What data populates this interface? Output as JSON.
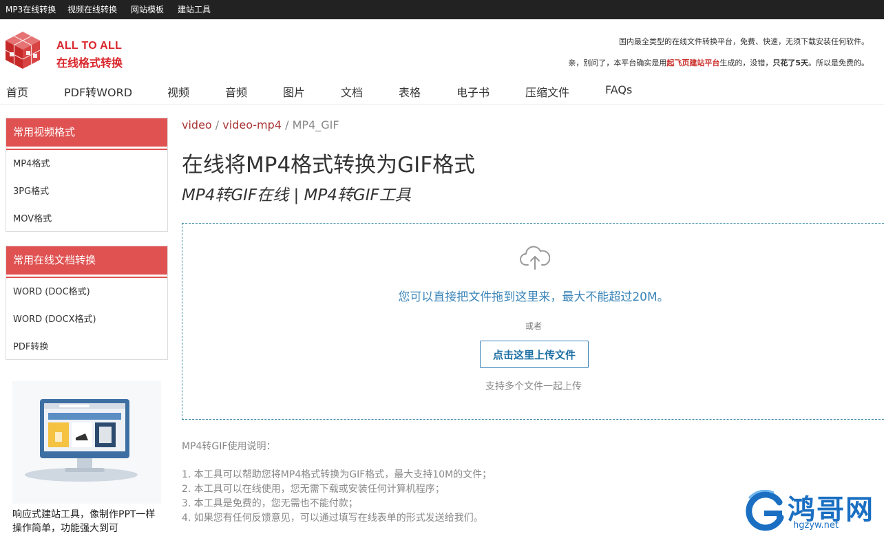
{
  "topnav": [
    "MP3在线转换",
    "视频在线转换",
    "网站模板",
    "建站工具"
  ],
  "brand": {
    "en": "ALL TO ALL",
    "cn": "在线格式转换"
  },
  "header": {
    "line1": "国内最全类型的在线文件转换平台，免费、快速，无须下载安装任何软件。",
    "line2_a": "亲，别问了，本平台确实是用",
    "line2_red": "起飞页建站平台",
    "line2_b": "生成的，没错，",
    "line2_bold": "只花了5天",
    "line2_c": "。所以是免费的。"
  },
  "mainnav": [
    "首页",
    "PDF转WORD",
    "视频",
    "音频",
    "图片",
    "文档",
    "表格",
    "电子书",
    "压缩文件",
    "FAQs"
  ],
  "sidebar": {
    "box1": {
      "title": "常用视频格式",
      "items": [
        "MP4格式",
        "3PG格式",
        "MOV格式"
      ]
    },
    "box2": {
      "title": "常用在线文档转换",
      "items": [
        "WORD (DOC格式)",
        "WORD (DOCX格式)",
        "PDF转换"
      ]
    },
    "promo_text": "响应式建站工具，像制作PPT一样操作简单，功能强大到可"
  },
  "breadcrumb": {
    "a": "video",
    "b": "video-mp4",
    "current": "MP4_GIF",
    "sep": "/"
  },
  "title": "在线将MP4格式转换为GIF格式",
  "subtitle": "MP4转GIF在线 | MP4转GIF工具",
  "dropzone": {
    "main": "您可以直接把文件拖到这里来，最大不能超过20M。",
    "or": "或者",
    "button": "点击这里上传文件",
    "multi": "支持多个文件一起上传"
  },
  "usage": {
    "title": "MP4转GIF使用说明：",
    "items": [
      "1. 本工具可以帮助您将MP4格式转换为GIF格式，最大支持10M的文件；",
      "2. 本工具可以在线使用，您无需下载或安装任何计算机程序；",
      "3. 本工具是免费的，您无需也不能付款；",
      "4. 如果您有任何反馈意见，可以通过填写在线表单的形式发送给我们。"
    ]
  },
  "watermark": {
    "text": "鸿哥网",
    "url": "hgzyw.net"
  },
  "colors": {
    "accent": "#e05252",
    "link_red": "#a33",
    "blue": "#3a84b8"
  }
}
